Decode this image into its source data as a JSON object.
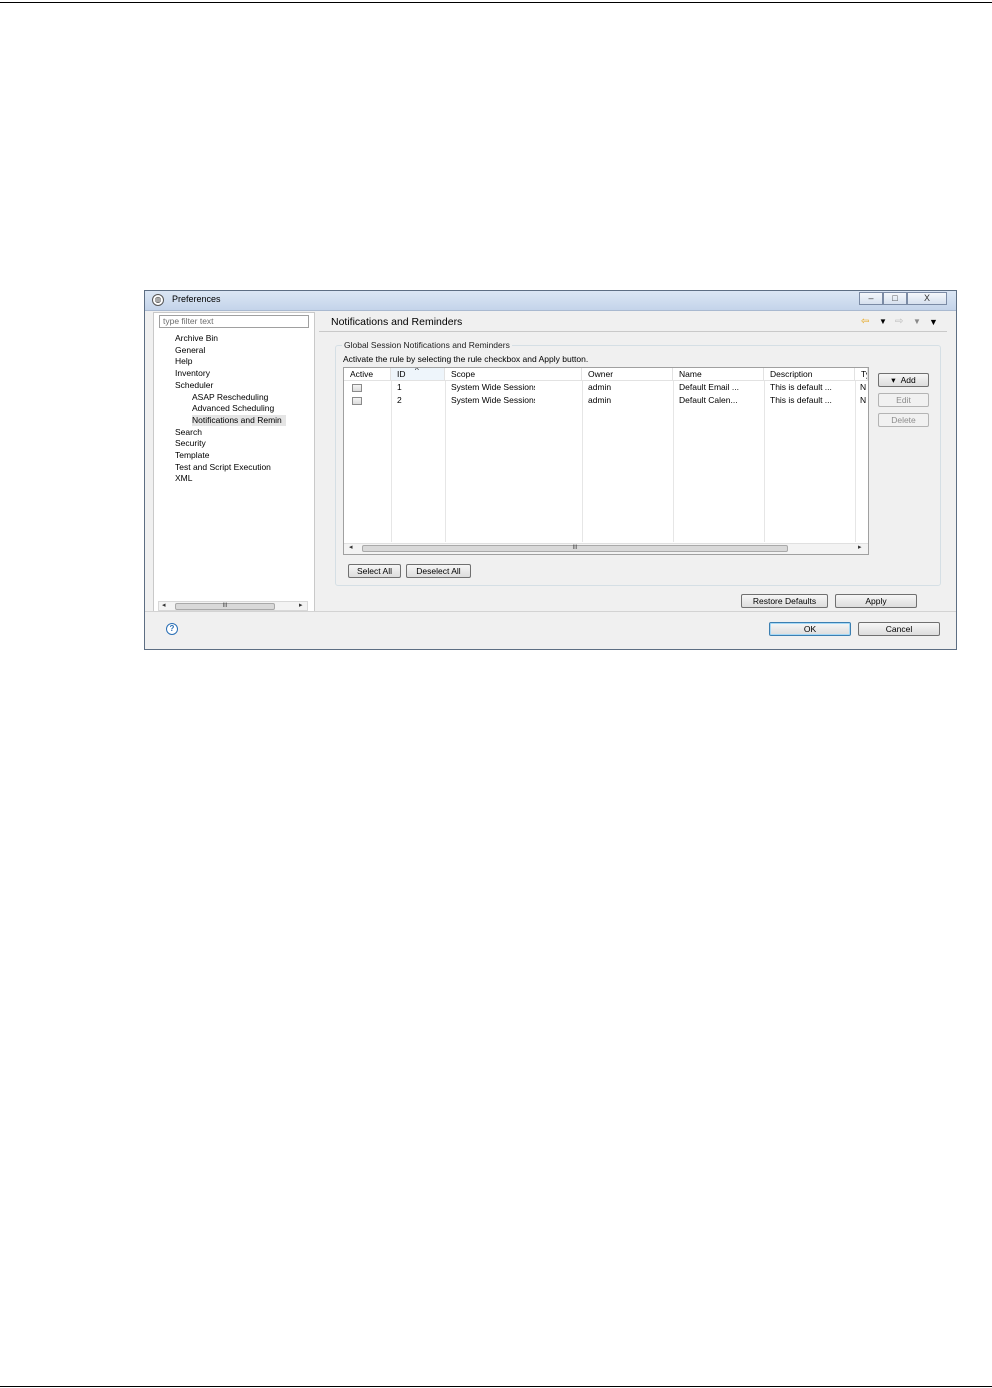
{
  "window": {
    "title": "Preferences",
    "controls": [
      "–",
      "□",
      "X"
    ]
  },
  "left": {
    "filter_placeholder": "type filter text",
    "tree": [
      {
        "label": "Archive Bin",
        "level": 0
      },
      {
        "label": "General",
        "level": 0
      },
      {
        "label": "Help",
        "level": 0
      },
      {
        "label": "Inventory",
        "level": 0
      },
      {
        "label": "Scheduler",
        "level": 0
      },
      {
        "label": "ASAP Rescheduling",
        "level": 1
      },
      {
        "label": "Advanced Scheduling",
        "level": 1
      },
      {
        "label": "Notifications and Remin",
        "level": 1,
        "selected": true
      },
      {
        "label": "Search",
        "level": 0
      },
      {
        "label": "Security",
        "level": 0
      },
      {
        "label": "Template",
        "level": 0
      },
      {
        "label": "Test and Script Execution",
        "level": 0
      },
      {
        "label": "XML",
        "level": 0
      }
    ],
    "scroll_thumb": "III",
    "scroll_left": "◂",
    "scroll_right": "▸"
  },
  "page": {
    "title": "Notifications and Reminders",
    "nav_icons": [
      "back-arrow",
      "dropdown",
      "forward-arrow",
      "dropdown",
      "view-menu"
    ]
  },
  "group": {
    "label": "Global Session Notifications and Reminders",
    "hint": "Activate the rule by selecting the rule checkbox and Apply button."
  },
  "table": {
    "columns": [
      "Active",
      "ID",
      "Scope",
      "Owner",
      "Name",
      "Description",
      "Ty"
    ],
    "sort_indicator": "^",
    "rows": [
      {
        "active": false,
        "id": "1",
        "scope": "System Wide Sessions",
        "owner": "admin",
        "name": "Default Email ...",
        "description": "This is default ...",
        "type": "N"
      },
      {
        "active": false,
        "id": "2",
        "scope": "System Wide Sessions",
        "owner": "admin",
        "name": "Default Calen...",
        "description": "This is default ...",
        "type": "N"
      }
    ],
    "scroll_thumb": "III",
    "scroll_left": "◂",
    "scroll_right": "▸"
  },
  "side_buttons": {
    "add": "Add",
    "add_icon": "▾",
    "edit": "Edit",
    "delete": "Delete"
  },
  "bottom_buttons": {
    "select_all": "Select All",
    "deselect_all": "Deselect All",
    "restore_defaults": "Restore Defaults",
    "apply": "Apply"
  },
  "dialog_buttons": {
    "help": "?",
    "ok": "OK",
    "cancel": "Cancel"
  },
  "colors": {
    "titlebar": "#c4d4ea",
    "dialog_bg": "#f0f0f0",
    "accent": "#3c7fb1",
    "back_arrow": "#e6a417"
  }
}
